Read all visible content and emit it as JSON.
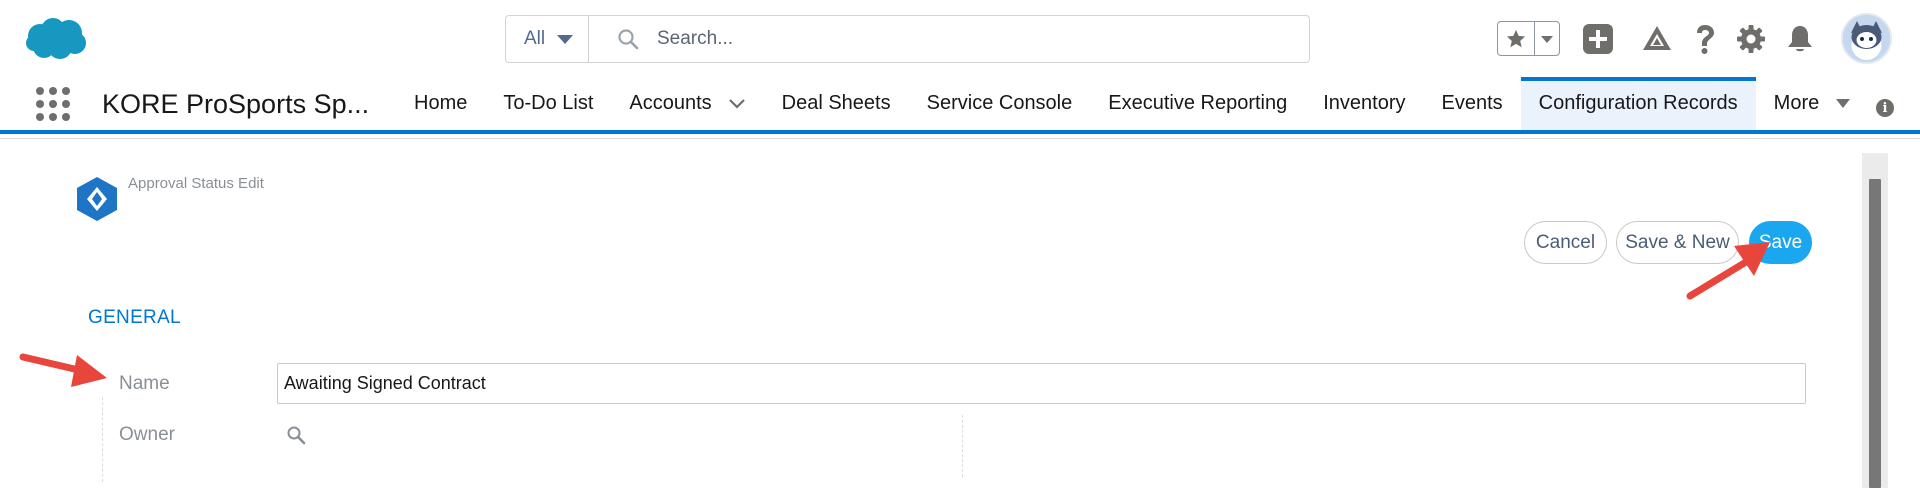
{
  "header": {
    "search": {
      "scope": "All",
      "placeholder": "Search..."
    },
    "icons": [
      "salesforce-cloud-icon",
      "favorites-star-icon",
      "add-icon",
      "trailhead-icon",
      "help-icon",
      "setup-gear-icon",
      "notifications-bell-icon"
    ]
  },
  "nav": {
    "app_name": "KORE ProSports Sp...",
    "items": [
      {
        "label": "Home"
      },
      {
        "label": "To-Do List"
      },
      {
        "label": "Accounts"
      },
      {
        "label": "Deal Sheets"
      },
      {
        "label": "Service Console"
      },
      {
        "label": "Executive Reporting"
      },
      {
        "label": "Inventory"
      },
      {
        "label": "Events"
      },
      {
        "label": "Configuration Records"
      },
      {
        "label": "More"
      }
    ],
    "active_item": "Configuration Records"
  },
  "page": {
    "title": "Approval Status Edit",
    "buttons": {
      "cancel": "Cancel",
      "save_new": "Save & New",
      "save": "Save"
    },
    "section": "GENERAL",
    "fields": {
      "name_label": "Name",
      "name_value": "Awaiting Signed Contract",
      "owner_label": "Owner"
    }
  },
  "colors": {
    "brand_blue": "#0176d3",
    "save_button": "#1ba6f0",
    "annotation_arrow": "#e8453c"
  }
}
